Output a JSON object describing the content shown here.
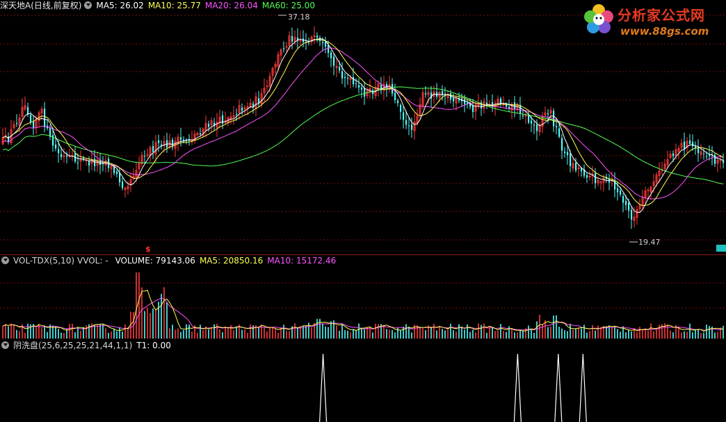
{
  "price_header": {
    "title": "深天地A(日线,前复权)",
    "ma5": "MA5: 26.02",
    "ma10": "MA10: 25.77",
    "ma20": "MA20: 26.04",
    "ma60": "MA60: 25.00"
  },
  "price_marks": {
    "high": "37.18",
    "low": "19.47"
  },
  "volume_header": {
    "title": "VOL-TDX(5,10)",
    "vvol": "VVOL: -",
    "volume": "VOLUME: 79143.06",
    "ma5": "MA5: 20850.16",
    "ma10": "MA10: 15172.46"
  },
  "indicator_header": {
    "title": "阴洗盘(25,6,25,25,21,44,1,1)",
    "t1": "T1: 0.00"
  },
  "signal_mark": "$",
  "watermark": {
    "name": "分析家公式网",
    "url": "www.88gs.com"
  },
  "colors": {
    "up": "#ff3c3c",
    "down": "#54fcfc",
    "ma5": "#ffffff",
    "ma10": "#ffff54",
    "ma20": "#ff54ff",
    "ma60": "#54ff54",
    "grid": "#7a1010",
    "panel_border": "#8a1a1a"
  },
  "chart_data": {
    "type": "candlestick",
    "y_range": [
      19.47,
      37.18
    ],
    "labeled_high": 37.18,
    "labeled_low": 19.47,
    "indicator_spikes_at_fraction": [
      0.445,
      0.713,
      0.769,
      0.803
    ]
  }
}
